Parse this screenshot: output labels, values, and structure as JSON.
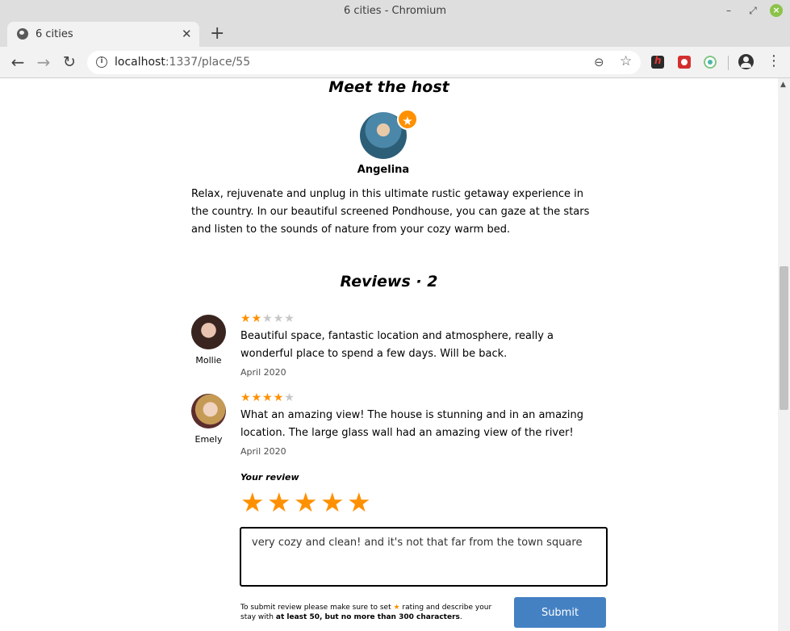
{
  "window": {
    "title": "6 cities - Chromium"
  },
  "tab": {
    "title": "6 cities"
  },
  "address_bar": {
    "host": "localhost",
    "rest": ":1337/place/55"
  },
  "host": {
    "section_title": "Meet the host",
    "name": "Angelina",
    "description": "Relax, rejuvenate and unplug in this ultimate rustic getaway experience in the country. In our beautiful screened Pondhouse, you can gaze at the stars and listen to the sounds of nature from your cozy warm bed."
  },
  "reviews": {
    "section_title": "Reviews · 2",
    "items": [
      {
        "user": "Mollie",
        "rating": 2,
        "max_rating": 5,
        "text": "Beautiful space, fantastic location and atmosphere, really a wonderful place to spend a few days. Will be back.",
        "date": "April 2020"
      },
      {
        "user": "Emely",
        "rating": 4,
        "max_rating": 5,
        "text": "What an amazing view! The house is stunning and in an amazing location. The large glass wall had an amazing view of the river!",
        "date": "April 2020"
      }
    ]
  },
  "form": {
    "label": "Your review",
    "rating": 5,
    "input_value": "very cozy and clean! and it's not that far from the town square",
    "helper_before": "To submit review please make sure to set ",
    "helper_middle": " rating and describe your stay with ",
    "helper_bold": "at least 50, but no more than 300 characters",
    "helper_after": ".",
    "submit_label": "Submit"
  },
  "colors": {
    "accent": "#ff9000",
    "button": "#4481c3"
  }
}
